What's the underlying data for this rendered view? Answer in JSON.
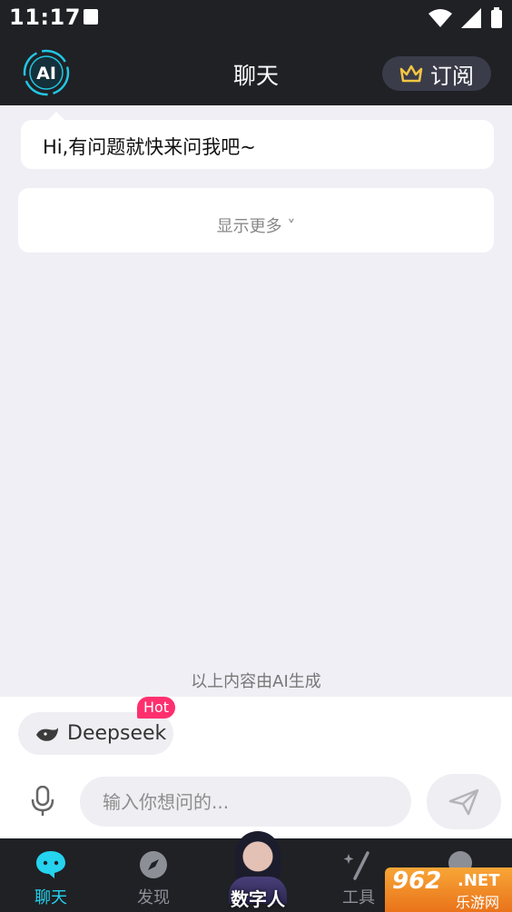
{
  "status": {
    "time": "11:17"
  },
  "header": {
    "title": "聊天",
    "subscribe_label": "订阅",
    "logo_text": "AI"
  },
  "chat": {
    "greeting": "Hi,有问题就快来问我吧~",
    "show_more": "显示更多 ˅",
    "disclaimer": "以上内容由AI生成"
  },
  "model_chip": {
    "label": "Deepseek",
    "badge": "Hot"
  },
  "input": {
    "placeholder": "输入你想问的..."
  },
  "nav": {
    "items": [
      {
        "label": "聊天",
        "icon": "chat-bubble-icon",
        "active": true
      },
      {
        "label": "发现",
        "icon": "compass-icon",
        "active": false
      },
      {
        "label": "数字人",
        "icon": "digital-human-avatar",
        "active": false
      },
      {
        "label": "工具",
        "icon": "magic-wand-icon",
        "active": false
      }
    ]
  },
  "watermark": {
    "num": "962",
    "net": ".NET",
    "cn": "乐游网"
  },
  "colors": {
    "accent": "#25d3ef",
    "dark_bar": "#1f2125",
    "hot": "#ff2f6e"
  }
}
